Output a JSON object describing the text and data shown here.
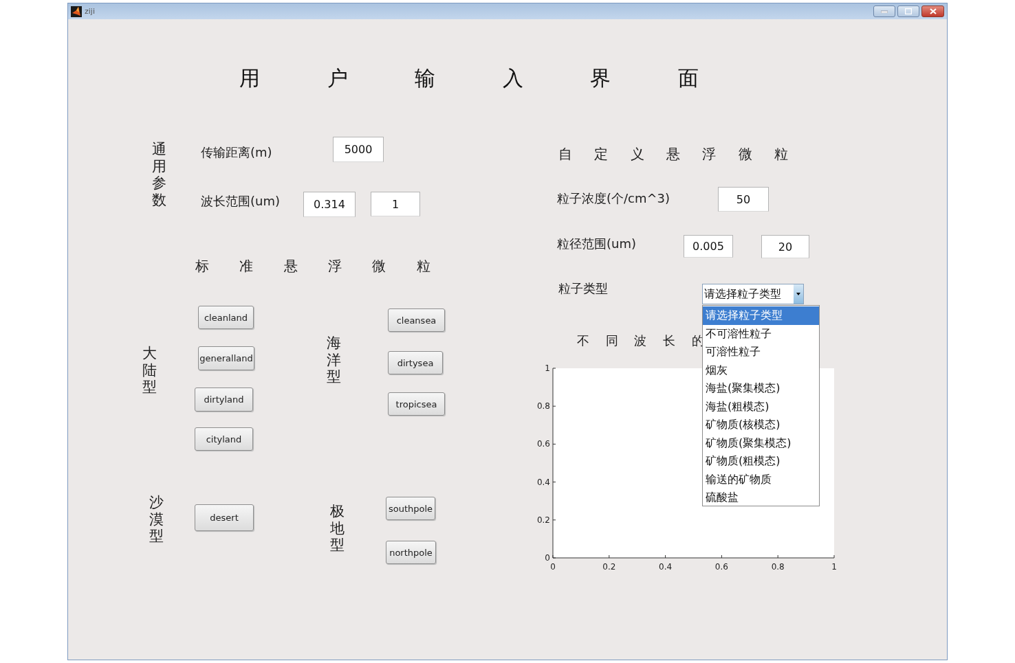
{
  "window": {
    "title": "ziji"
  },
  "heading": "用 户 输 入 界 面",
  "general": {
    "label": "通用参数",
    "fields": [
      {
        "label": "传输距离(m)",
        "values": [
          "5000"
        ]
      },
      {
        "label": "波长范围(um)",
        "values": [
          "0.314",
          "1"
        ]
      }
    ]
  },
  "standard": {
    "title": "标 准 悬 浮 微 粒",
    "groups": [
      {
        "label": "大陆型",
        "buttons": [
          "cleanland",
          "generalland",
          "dirtyland",
          "cityland"
        ]
      },
      {
        "label": "海洋型",
        "buttons": [
          "cleansea",
          "dirtysea",
          "tropicsea"
        ]
      },
      {
        "label": "沙漠型",
        "buttons": [
          "desert"
        ]
      },
      {
        "label": "极地型",
        "buttons": [
          "southpole",
          "northpole"
        ]
      }
    ]
  },
  "custom": {
    "title": "自 定 义 悬 浮 微 粒",
    "fields": [
      {
        "label": "粒子浓度(个/cm^3)",
        "values": [
          "50"
        ]
      },
      {
        "label": "粒径范围(um)",
        "values": [
          "0.005",
          "20"
        ]
      }
    ],
    "type_select": {
      "label": "粒子类型",
      "value": "请选择粒子类型",
      "expanded": true,
      "options": [
        {
          "label": "请选择粒子类型",
          "selected": true
        },
        {
          "label": "不可溶性粒子",
          "selected": false
        },
        {
          "label": "可溶性粒子",
          "selected": false
        },
        {
          "label": "烟灰",
          "selected": false
        },
        {
          "label": "海盐(聚集模态)",
          "selected": false
        },
        {
          "label": "海盐(粗模态)",
          "selected": false
        },
        {
          "label": "矿物质(核模态)",
          "selected": false
        },
        {
          "label": "矿物质(聚集模态)",
          "selected": false
        },
        {
          "label": "矿物质(粗模态)",
          "selected": false
        },
        {
          "label": "输送的矿物质",
          "selected": false
        },
        {
          "label": "硫酸盐",
          "selected": false
        }
      ]
    }
  },
  "chart": {
    "chart_data": {
      "type": "line",
      "title": "不 同 波 长 的",
      "xlim": [
        0,
        1
      ],
      "ylim": [
        0,
        1
      ],
      "xticks": [
        0,
        0.2,
        0.4,
        0.6,
        0.8,
        1
      ],
      "yticks": [
        0,
        0.2,
        0.4,
        0.6,
        0.8,
        1
      ]
    }
  }
}
